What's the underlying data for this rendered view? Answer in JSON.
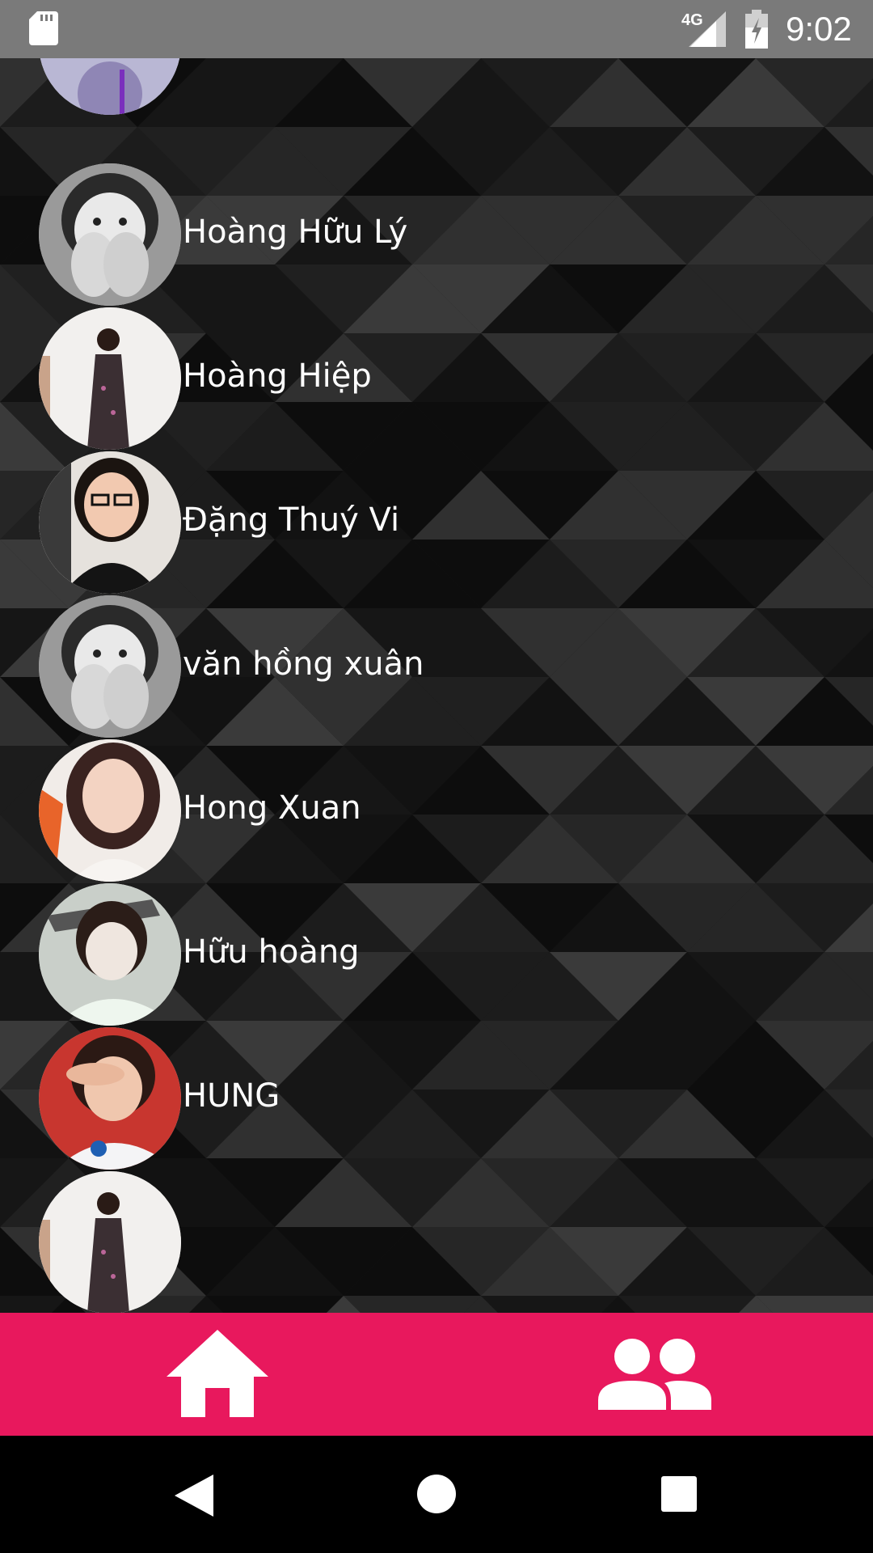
{
  "status_bar": {
    "time": "9:02",
    "network": "4G",
    "icons": [
      "sd-card-icon",
      "signal-icon",
      "battery-charging-icon"
    ]
  },
  "colors": {
    "status_bar": "#7a7a7a",
    "accent": "#e8185d",
    "text": "#ffffff"
  },
  "friends": [
    {
      "name": "",
      "avatar": "avatar-partial"
    },
    {
      "name": "Hoàng Hữu Lý",
      "avatar": "avatar-bw-hands"
    },
    {
      "name": "Hoàng Hiệp",
      "avatar": "avatar-girl-dress"
    },
    {
      "name": "Đặng Thuý Vi",
      "avatar": "avatar-glasses"
    },
    {
      "name": "văn hồng xuân",
      "avatar": "avatar-bw-hands"
    },
    {
      "name": "Hong Xuan",
      "avatar": "avatar-girl-smile"
    },
    {
      "name": "Hữu hoàng",
      "avatar": "avatar-girl-salute"
    },
    {
      "name": "HUNG",
      "avatar": "avatar-girl-red"
    },
    {
      "name": "",
      "avatar": "avatar-girl-dress"
    }
  ],
  "bottom_nav": {
    "items": [
      {
        "icon": "home-icon"
      },
      {
        "icon": "people-icon"
      }
    ]
  },
  "system_nav": {
    "items": [
      "back-icon",
      "home-circle-icon",
      "recents-icon"
    ]
  }
}
